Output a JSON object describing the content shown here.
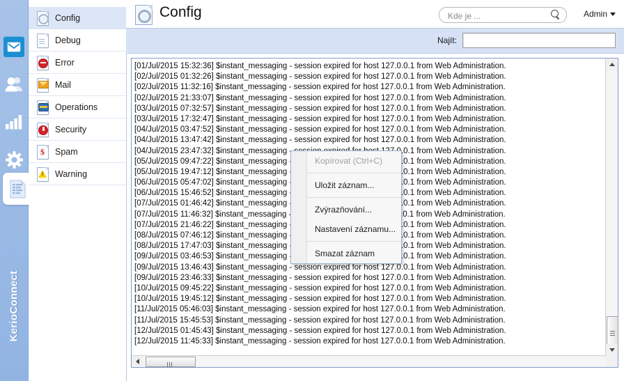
{
  "brand": "KerioConnect",
  "rail": {
    "items": [
      {
        "name": "mail-icon",
        "selected": true
      },
      {
        "name": "users-icon",
        "selected": false
      },
      {
        "name": "statistics-icon",
        "selected": false
      },
      {
        "name": "settings-gear-icon",
        "selected": false
      }
    ],
    "active_tab_icon": "logs-icon"
  },
  "sidebar": {
    "items": [
      {
        "label": "Config",
        "icon": "config-log-icon",
        "selected": true
      },
      {
        "label": "Debug",
        "icon": "debug-log-icon",
        "selected": false
      },
      {
        "label": "Error",
        "icon": "error-log-icon",
        "selected": false
      },
      {
        "label": "Mail",
        "icon": "mail-log-icon",
        "selected": false
      },
      {
        "label": "Operations",
        "icon": "operations-log-icon",
        "selected": false
      },
      {
        "label": "Security",
        "icon": "security-log-icon",
        "selected": false
      },
      {
        "label": "Spam",
        "icon": "spam-log-icon",
        "selected": false
      },
      {
        "label": "Warning",
        "icon": "warning-log-icon",
        "selected": false
      }
    ]
  },
  "header": {
    "title": "Config",
    "title_icon": "config-gear-document-icon",
    "search": {
      "value": "",
      "placeholder": "Kde je ...",
      "icon": "search-icon"
    },
    "account": {
      "label": "Admin",
      "caret": "chevron-down-icon"
    }
  },
  "toolbar": {
    "find_label": "Najít:",
    "find_value": "",
    "find_placeholder": ""
  },
  "context_menu": {
    "items": [
      {
        "label": "Kopírovat (Ctrl+C)",
        "disabled": true,
        "separator_after": true
      },
      {
        "label": "Uložit záznam...",
        "disabled": false,
        "separator_after": true
      },
      {
        "label": "Zvýrazňování...",
        "disabled": false,
        "separator_after": false
      },
      {
        "label": "Nastavení záznamu...",
        "disabled": false,
        "separator_after": true
      },
      {
        "label": "Smazat záznam",
        "disabled": false,
        "separator_after": false
      }
    ]
  },
  "log": {
    "line_suffix": "$instant_messaging - session expired for host 127.0.0.1 from Web Administration.",
    "lines": [
      "[01/Jul/2015 15:32:36] $instant_messaging - session expired for host 127.0.0.1 from Web Administration.",
      "[02/Jul/2015 01:32:26] $instant_messaging - session expired for host 127.0.0.1 from Web Administration.",
      "[02/Jul/2015 11:32:16] $instant_messaging - session expired for host 127.0.0.1 from Web Administration.",
      "[02/Jul/2015 21:33:07] $instant_messaging - session expired for host 127.0.0.1 from Web Administration.",
      "[03/Jul/2015 07:32:57] $instant_messaging - session expired for host 127.0.0.1 from Web Administration.",
      "[03/Jul/2015 17:32:47] $instant_messaging - session expired for host 127.0.0.1 from Web Administration.",
      "[04/Jul/2015 03:47:52] $instant_messaging - session expired for host 127.0.0.1 from Web Administration.",
      "[04/Jul/2015 13:47:42] $instant_messaging - session expired for host 127.0.0.1 from Web Administration.",
      "[04/Jul/2015 23:47:32] $instant_messaging - session expired for host 127.0.0.1 from Web Administration.",
      "[05/Jul/2015 09:47:22] $instant_messaging - session expired for host 127.0.0.1 from Web Administration.",
      "[05/Jul/2015 19:47:12] $instant_messaging - session expired for host 127.0.0.1 from Web Administration.",
      "[06/Jul/2015 05:47:02] $instant_messaging - session expired for host 127.0.0.1 from Web Administration.",
      "[06/Jul/2015 15:46:52] $instant_messaging - session expired for host 127.0.0.1 from Web Administration.",
      "[07/Jul/2015 01:46:42] $instant_messaging - session expired for host 127.0.0.1 from Web Administration.",
      "[07/Jul/2015 11:46:32] $instant_messaging - session expired for host 127.0.0.1 from Web Administration.",
      "[07/Jul/2015 21:46:22] $instant_messaging - session expired for host 127.0.0.1 from Web Administration.",
      "[08/Jul/2015 07:46:12] $instant_messaging - session expired for host 127.0.0.1 from Web Administration.",
      "[08/Jul/2015 17:47:03] $instant_messaging - session expired for host 127.0.0.1 from Web Administration.",
      "[09/Jul/2015 03:46:53] $instant_messaging - session expired for host 127.0.0.1 from Web Administration.",
      "[09/Jul/2015 13:46:43] $instant_messaging - session expired for host 127.0.0.1 from Web Administration.",
      "[09/Jul/2015 23:46:33] $instant_messaging - session expired for host 127.0.0.1 from Web Administration.",
      "[10/Jul/2015 09:45:22] $instant_messaging - session expired for host 127.0.0.1 from Web Administration.",
      "[10/Jul/2015 19:45:12] $instant_messaging - session expired for host 127.0.0.1 from Web Administration.",
      "[11/Jul/2015 05:46:03] $instant_messaging - session expired for host 127.0.0.1 from Web Administration.",
      "[11/Jul/2015 15:45:53] $instant_messaging - session expired for host 127.0.0.1 from Web Administration.",
      "[12/Jul/2015 01:45:43] $instant_messaging - session expired for host 127.0.0.1 from Web Administration.",
      "[12/Jul/2015 11:45:33] $instant_messaging - session expired for host 127.0.0.1 from Web Administration."
    ]
  },
  "colors": {
    "rail_blue": "#9dbce6",
    "accent_blue": "#1c8fd0",
    "toolbar_blue": "#d7e1f6",
    "selection_blue": "#dce6f7",
    "panel_border": "#7f9dc9"
  }
}
